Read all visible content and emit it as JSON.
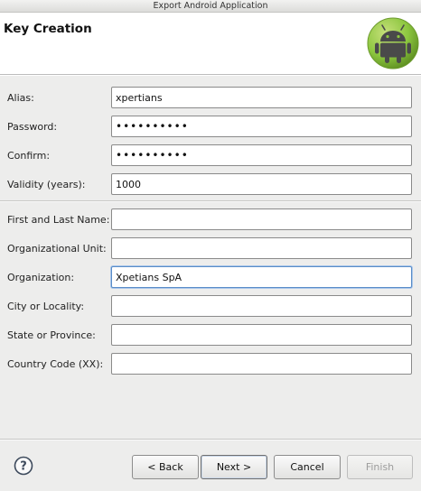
{
  "window": {
    "title": "Export Android Application"
  },
  "header": {
    "title": "Key Creation",
    "logo_icon": "android-logo-icon"
  },
  "form": {
    "keystore": {
      "alias": {
        "label": "Alias:",
        "value": "xpertians"
      },
      "password": {
        "label": "Password:",
        "value": "••••••••••"
      },
      "confirm": {
        "label": "Confirm:",
        "value": "••••••••••"
      },
      "validity": {
        "label": "Validity (years):",
        "value": "1000"
      }
    },
    "certificate": {
      "name": {
        "label": "First and Last Name:",
        "value": ""
      },
      "org_unit": {
        "label": "Organizational Unit:",
        "value": ""
      },
      "organization": {
        "label": "Organization:",
        "value": "Xpetians SpA"
      },
      "city": {
        "label": "City or Locality:",
        "value": ""
      },
      "state": {
        "label": "State or Province:",
        "value": ""
      },
      "country": {
        "label": "Country Code (XX):",
        "value": ""
      }
    }
  },
  "footer": {
    "help_icon": "help-icon",
    "back_label": "< Back",
    "next_label": "Next >",
    "cancel_label": "Cancel",
    "finish_label": "Finish"
  },
  "colors": {
    "accent_focus": "#5a8dc8",
    "android_green": "#8cc63f"
  }
}
